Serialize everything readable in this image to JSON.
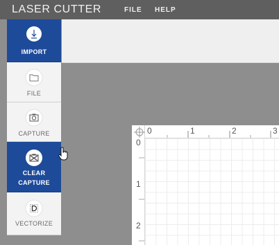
{
  "app": {
    "title": "LASER CUTTER"
  },
  "menu": {
    "file": "FILE",
    "help": "HELP"
  },
  "sidebar": {
    "import": {
      "label": "IMPORT",
      "icon": "import-icon"
    },
    "file": {
      "label": "FILE",
      "icon": "folder-icon"
    },
    "capture": {
      "label": "CAPTURE",
      "icon": "camera-icon"
    },
    "clear_capture": {
      "label_line1": "CLEAR",
      "label_line2": "CAPTURE",
      "icon": "clear-camera-icon"
    },
    "vectorize": {
      "label": "VECTORIZE",
      "icon": "vectorize-icon"
    }
  },
  "rulers": {
    "top": [
      "0",
      "1",
      "2",
      "3"
    ],
    "left": [
      "0",
      "1",
      "2"
    ]
  },
  "colors": {
    "titlebar": "#5f5f5f",
    "accent_blue": "#1e4a9a",
    "workspace": "#8e8e8e"
  }
}
